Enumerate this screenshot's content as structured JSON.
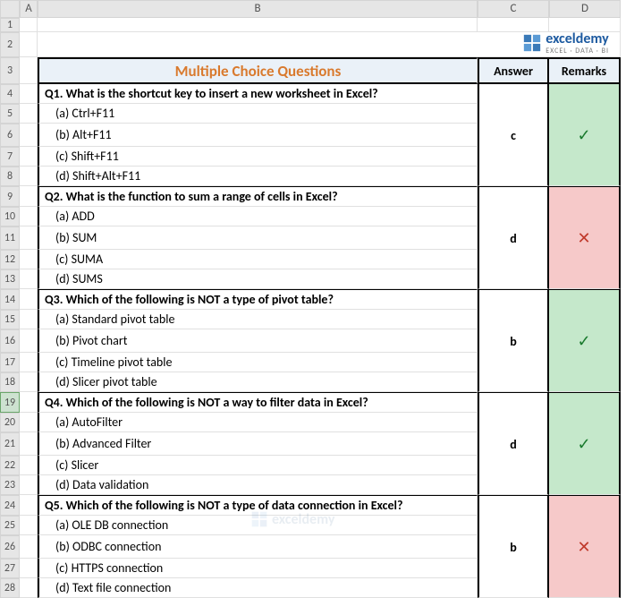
{
  "columns": [
    "A",
    "B",
    "C",
    "D"
  ],
  "header": {
    "title": "Multiple Choice Questions",
    "answer": "Answer",
    "remarks": "Remarks"
  },
  "logo": {
    "name": "exceldemy",
    "tagline": "EXCEL · DATA · BI"
  },
  "questions": [
    {
      "q": "Q1. What is the shortcut key to insert a new worksheet in Excel?",
      "opts": [
        "(a) Ctrl+F11",
        "(b) Alt+F11",
        "(c) Shift+F11",
        "(d) Shift+Alt+F11"
      ],
      "answer": "c",
      "correct": true
    },
    {
      "q": "Q2. What is the function to sum a range of cells in Excel?",
      "opts": [
        "(a) ADD",
        "(b) SUM",
        "(c) SUMA",
        "(d) SUMS"
      ],
      "answer": "d",
      "correct": false
    },
    {
      "q": "Q3. Which of the following is NOT a type of pivot table?",
      "opts": [
        "(a) Standard pivot table",
        "(b) Pivot chart",
        "(c) Timeline pivot table",
        "(d) Slicer pivot table"
      ],
      "answer": "b",
      "correct": true
    },
    {
      "q": "Q4. Which of the following is NOT a way to filter data in Excel?",
      "opts": [
        "(a) AutoFilter",
        "(b) Advanced Filter",
        "(c) Slicer",
        "(d) Data validation"
      ],
      "answer": "d",
      "correct": true
    },
    {
      "q": "Q5. Which of the following is NOT a type of data connection in Excel?",
      "opts": [
        "(a) OLE DB connection",
        "(b) ODBC connection",
        "(c) HTTPS connection",
        "(d) Text file connection"
      ],
      "answer": "b",
      "correct": false
    }
  ],
  "marks": {
    "check": "✓",
    "cross": "✕"
  },
  "selectedRow": 19
}
